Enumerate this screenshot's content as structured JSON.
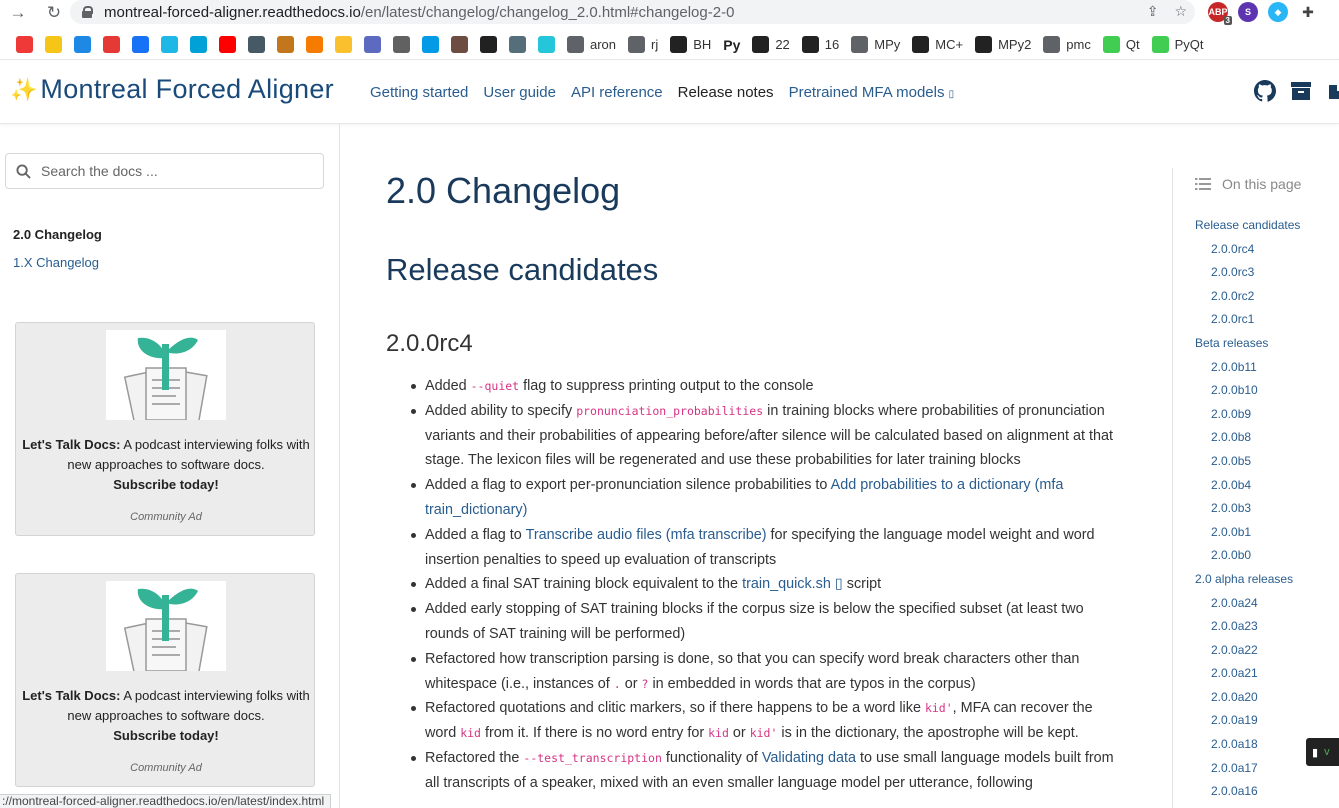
{
  "browser": {
    "url_host": "montreal-forced-aligner.readthedocs.io",
    "url_path": "/en/latest/changelog/changelog_2.0.html#changelog-2-0",
    "status_url": "://montreal-forced-aligner.readthedocs.io/en/latest/index.html",
    "ext_badge": "3",
    "bookmarks": [
      {
        "label": "",
        "icon": "vivaldi-icon",
        "color": "#ef3939"
      },
      {
        "label": "",
        "icon": "sparkle-icon",
        "color": "#f5c518"
      },
      {
        "label": "",
        "icon": "translate-icon",
        "color": "#1e88e5"
      },
      {
        "label": "",
        "icon": "y-icon",
        "color": "#e53935"
      },
      {
        "label": "",
        "icon": "zhihu-icon",
        "color": "#1772f6"
      },
      {
        "label": "",
        "icon": "tap-icon",
        "color": "#1eb7e6"
      },
      {
        "label": "",
        "icon": "bilibili-icon",
        "color": "#00a1d6"
      },
      {
        "label": "",
        "icon": "youtube-icon",
        "color": "#ff0000"
      },
      {
        "label": "",
        "icon": "bookmark-icon",
        "color": "#455a64"
      },
      {
        "label": "",
        "icon": "deer-icon",
        "color": "#c2771d"
      },
      {
        "label": "",
        "icon": "orange-icon",
        "color": "#f57c00"
      },
      {
        "label": "",
        "icon": "duck-icon",
        "color": "#fbc02d"
      },
      {
        "label": "",
        "icon": "image-icon",
        "color": "#5c6bc0"
      },
      {
        "label": "",
        "icon": "moon-icon",
        "color": "#616161"
      },
      {
        "label": "",
        "icon": "v-icon",
        "color": "#039be5"
      },
      {
        "label": "",
        "icon": "leaf-icon",
        "color": "#6d4c41"
      },
      {
        "label": "",
        "icon": "g-icon",
        "color": "#212121"
      },
      {
        "label": "",
        "icon": "trees-icon",
        "color": "#546e7a"
      },
      {
        "label": "",
        "icon": "circle-icon",
        "color": "#26c6da"
      },
      {
        "label": "aron",
        "icon": "globe-icon",
        "color": "#5f6368"
      },
      {
        "label": "rj",
        "icon": "git-icon",
        "color": "#5f6368"
      },
      {
        "label": "BH",
        "icon": "gh-icon",
        "color": "#222222"
      },
      {
        "label": "",
        "icon": "py-icon",
        "color": "#222222"
      },
      {
        "label": "22",
        "icon": "slash-icon",
        "color": "#222222"
      },
      {
        "label": "16",
        "icon": "slash-icon",
        "color": "#222222"
      },
      {
        "label": "MPy",
        "icon": "globe-icon",
        "color": "#5f6368"
      },
      {
        "label": "MC+",
        "icon": "slash-icon",
        "color": "#222222"
      },
      {
        "label": "MPy2",
        "icon": "slash-icon",
        "color": "#222222"
      },
      {
        "label": "pmc",
        "icon": "globe-icon",
        "color": "#5f6368"
      },
      {
        "label": "Qt",
        "icon": "qt-icon",
        "color": "#41cd52"
      },
      {
        "label": "PyQt",
        "icon": "pyqt-icon",
        "color": "#41cd52"
      }
    ],
    "py_text": "Py"
  },
  "header": {
    "brand": "Montreal Forced Aligner",
    "nav": [
      {
        "label": "Getting started",
        "active": false
      },
      {
        "label": "User guide",
        "active": false
      },
      {
        "label": "API reference",
        "active": false
      },
      {
        "label": "Release notes",
        "active": true
      },
      {
        "label": "Pretrained MFA models",
        "active": false
      }
    ],
    "external_glyph": "▯"
  },
  "sidebar": {
    "search_placeholder": "Search the docs ...",
    "items": [
      "2.0 Changelog",
      "1.X Changelog"
    ],
    "ads": [
      {
        "title": "Let's Talk Docs:",
        "body": " A podcast interviewing folks with new approaches to software docs.",
        "cta": "Subscribe today!",
        "footer": "Community Ad"
      },
      {
        "title": "Let's Talk Docs:",
        "body": " A podcast interviewing folks with new approaches to software docs.",
        "cta": "Subscribe today!",
        "footer": "Community Ad"
      }
    ]
  },
  "content": {
    "title": "2.0 Changelog",
    "section": "Release candidates",
    "subsection": "2.0.0rc4",
    "bullets": [
      [
        [
          "t",
          "Added "
        ],
        [
          "c",
          "--quiet"
        ],
        [
          "t",
          " flag to suppress printing output to the console"
        ]
      ],
      [
        [
          "t",
          "Added ability to specify "
        ],
        [
          "c",
          "pronunciation_probabilities"
        ],
        [
          "t",
          " in training blocks where probabilities of pronunciation variants and their probabilities of appearing before/after silence will be calculated based on alignment at that stage. The lexicon files will be regenerated and use these probabilities for later training blocks"
        ]
      ],
      [
        [
          "t",
          "Added a flag to export per-pronunciation silence probabilities to "
        ],
        [
          "l",
          "Add probabilities to a dictionary (mfa train_dictionary)"
        ]
      ],
      [
        [
          "t",
          "Added a flag to "
        ],
        [
          "l",
          "Transcribe audio files (mfa transcribe)"
        ],
        [
          "t",
          " for specifying the language model weight and word insertion penalties to speed up evaluation of transcripts"
        ]
      ],
      [
        [
          "t",
          "Added a final SAT training block equivalent to the "
        ],
        [
          "l",
          "train_quick.sh ▯"
        ],
        [
          "t",
          " script"
        ]
      ],
      [
        [
          "t",
          "Added early stopping of SAT training blocks if the corpus size is below the specified subset (at least two rounds of SAT training will be performed)"
        ]
      ],
      [
        [
          "t",
          "Refactored how transcription parsing is done, so that you can specify word break characters other than whitespace (i.e., instances of "
        ],
        [
          "c",
          "."
        ],
        [
          "t",
          " or "
        ],
        [
          "c",
          "?"
        ],
        [
          "t",
          " in embedded in words that are typos in the corpus)"
        ]
      ],
      [
        [
          "t",
          "Refactored quotations and clitic markers, so if there happens to be a word like "
        ],
        [
          "c",
          "kid'"
        ],
        [
          "t",
          ", MFA can recover the word "
        ],
        [
          "c",
          "kid"
        ],
        [
          "t",
          " from it. If there is no word entry for "
        ],
        [
          "c",
          "kid"
        ],
        [
          "t",
          " or "
        ],
        [
          "c",
          "kid'"
        ],
        [
          "t",
          " is in the dictionary, the apostrophe will be kept."
        ]
      ],
      [
        [
          "t",
          "Refactored the "
        ],
        [
          "c",
          "--test_transcription"
        ],
        [
          "t",
          " functionality of "
        ],
        [
          "l",
          "Validating data"
        ],
        [
          "t",
          " to use small language models built from all transcripts of a speaker, mixed with an even smaller language model per utterance, following"
        ]
      ]
    ]
  },
  "toc": {
    "heading": "On this page",
    "items": [
      {
        "label": "Release candidates",
        "level": 1
      },
      {
        "label": "2.0.0rc4",
        "level": 2
      },
      {
        "label": "2.0.0rc3",
        "level": 2
      },
      {
        "label": "2.0.0rc2",
        "level": 2
      },
      {
        "label": "2.0.0rc1",
        "level": 2
      },
      {
        "label": "Beta releases",
        "level": 1
      },
      {
        "label": "2.0.0b11",
        "level": 2
      },
      {
        "label": "2.0.0b10",
        "level": 2
      },
      {
        "label": "2.0.0b9",
        "level": 2
      },
      {
        "label": "2.0.0b8",
        "level": 2
      },
      {
        "label": "2.0.0b5",
        "level": 2
      },
      {
        "label": "2.0.0b4",
        "level": 2
      },
      {
        "label": "2.0.0b3",
        "level": 2
      },
      {
        "label": "2.0.0b1",
        "level": 2
      },
      {
        "label": "2.0.0b0",
        "level": 2
      },
      {
        "label": "2.0 alpha releases",
        "level": 1
      },
      {
        "label": "2.0.0a24",
        "level": 2
      },
      {
        "label": "2.0.0a23",
        "level": 2
      },
      {
        "label": "2.0.0a22",
        "level": 2
      },
      {
        "label": "2.0.0a21",
        "level": 2
      },
      {
        "label": "2.0.0a20",
        "level": 2
      },
      {
        "label": "2.0.0a19",
        "level": 2
      },
      {
        "label": "2.0.0a18",
        "level": 2
      },
      {
        "label": "2.0.0a17",
        "level": 2
      },
      {
        "label": "2.0.0a16",
        "level": 2
      }
    ],
    "floating_label": "v"
  }
}
